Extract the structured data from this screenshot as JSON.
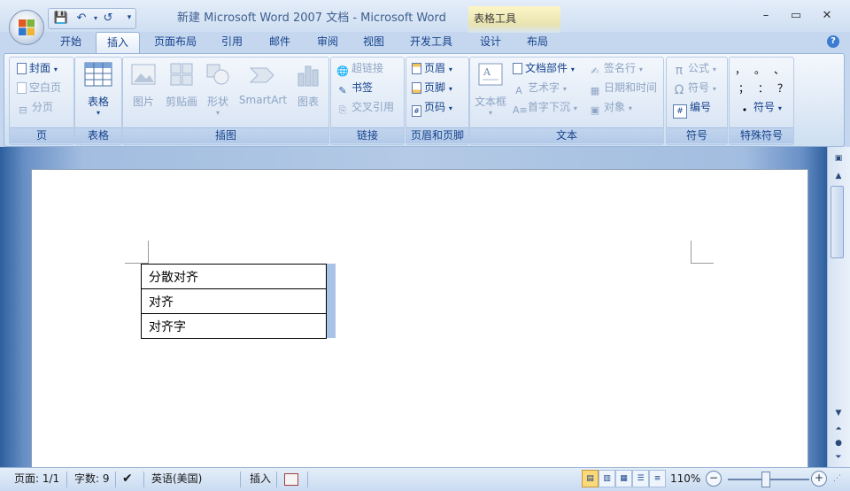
{
  "window": {
    "title": "新建 Microsoft Word 2007 文档 - Microsoft Word",
    "context_tab": "表格工具",
    "minimize": "–",
    "maximize": "▭",
    "close": "✕"
  },
  "qat": {
    "save": "💾",
    "undo": "↶",
    "redo": "↺",
    "more": "▾"
  },
  "tabs": [
    {
      "label": "开始"
    },
    {
      "label": "插入"
    },
    {
      "label": "页面布局"
    },
    {
      "label": "引用"
    },
    {
      "label": "邮件"
    },
    {
      "label": "审阅"
    },
    {
      "label": "视图"
    },
    {
      "label": "开发工具"
    },
    {
      "label": "设计"
    },
    {
      "label": "布局"
    }
  ],
  "ribbon": {
    "page_group": {
      "label": "页",
      "cover": "封面",
      "blank": "空白页",
      "break": "分页"
    },
    "table_group": {
      "label": "表格",
      "table": "表格"
    },
    "illus_group": {
      "label": "插图",
      "picture": "图片",
      "clipart": "剪贴画",
      "shapes": "形状",
      "smartart": "SmartArt",
      "chart": "图表"
    },
    "link_group": {
      "label": "链接",
      "hyperlink": "超链接",
      "bookmark": "书签",
      "crossref": "交叉引用"
    },
    "hf_group": {
      "label": "页眉和页脚",
      "header": "页眉",
      "footer": "页脚",
      "pagenum": "页码"
    },
    "text_group": {
      "label": "文本",
      "textbox": "文本框",
      "parts": "文档部件",
      "wordart": "艺术字",
      "dropcap": "首字下沉",
      "signature": "签名行",
      "datetime": "日期和时间",
      "object": "对象"
    },
    "symbol_group": {
      "label": "符号",
      "equation": "公式",
      "symbol": "符号",
      "number": "编号"
    },
    "special_group": {
      "label": "特殊符号",
      "row1": [
        "，",
        "。",
        "、"
      ],
      "row2": [
        "；",
        "：",
        "？"
      ],
      "symbol": "符号"
    }
  },
  "document": {
    "rows": [
      {
        "text": "分散对齐"
      },
      {
        "text": "对齐"
      },
      {
        "text": "对齐字"
      }
    ]
  },
  "status": {
    "page": "页面: 1/1",
    "words": "字数: 9",
    "language": "英语(美国)",
    "mode": "插入",
    "zoom": "110%",
    "zoom_minus": "−",
    "zoom_plus": "+"
  }
}
